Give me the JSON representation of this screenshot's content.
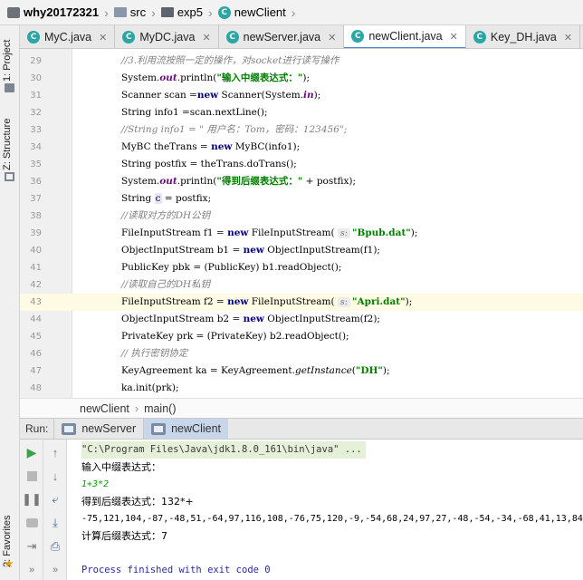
{
  "breadcrumb": {
    "project": "why20172321",
    "src": "src",
    "package": "exp5",
    "file": "newClient"
  },
  "left_tool_windows": {
    "project": "1: Project",
    "structure": "Z: Structure",
    "favorites": "2: Favorites"
  },
  "tabs": [
    {
      "label": "MyC.java"
    },
    {
      "label": "MyDC.java"
    },
    {
      "label": "newServer.java"
    },
    {
      "label": "newClient.java",
      "active": true
    },
    {
      "label": "Key_DH.java"
    }
  ],
  "editor": {
    "highlighted_line": "43",
    "lines": [
      {
        "n": "29",
        "segs": [
          {
            "t": "//3.利用流按照一定的操作，对",
            "c": "cmt"
          },
          {
            "t": "socket",
            "c": "cmt"
          },
          {
            "t": "进行读写操作",
            "c": "cmt"
          }
        ]
      },
      {
        "n": "30",
        "segs": [
          {
            "t": "System."
          },
          {
            "t": "out",
            "c": "fld"
          },
          {
            "t": ".println("
          },
          {
            "t": "\"输入中缀表达式：\"",
            "c": "str"
          },
          {
            "t": ");"
          }
        ]
      },
      {
        "n": "31",
        "segs": [
          {
            "t": "Scanner scan ="
          },
          {
            "t": "new",
            "c": "kw"
          },
          {
            "t": " Scanner(System."
          },
          {
            "t": "in",
            "c": "fld"
          },
          {
            "t": ");"
          }
        ]
      },
      {
        "n": "32",
        "segs": [
          {
            "t": "String info1 =scan.nextLine();"
          }
        ]
      },
      {
        "n": "33",
        "segs": [
          {
            "t": "//String info1 = \" 用户名：Tom，密码：123456\";",
            "c": "cmt"
          }
        ]
      },
      {
        "n": "34",
        "segs": [
          {
            "t": "MyBC theTrans = "
          },
          {
            "t": "new",
            "c": "kw"
          },
          {
            "t": " MyBC(info1);"
          }
        ]
      },
      {
        "n": "35",
        "segs": [
          {
            "t": "String postfix = theTrans.doTrans();"
          }
        ]
      },
      {
        "n": "36",
        "segs": [
          {
            "t": "System."
          },
          {
            "t": "out",
            "c": "fld"
          },
          {
            "t": ".println("
          },
          {
            "t": "\"得到后缀表达式：\"",
            "c": "str"
          },
          {
            "t": " + postfix);"
          }
        ]
      },
      {
        "n": "37",
        "segs": [
          {
            "t": "String "
          },
          {
            "t": "c",
            "c": "varbox"
          },
          {
            "t": " = postfix;"
          }
        ]
      },
      {
        "n": "38",
        "segs": [
          {
            "t": "//读取对方的DH公钥",
            "c": "cmt"
          }
        ]
      },
      {
        "n": "39",
        "segs": [
          {
            "t": "FileInputStream f1 = "
          },
          {
            "t": "new",
            "c": "kw"
          },
          {
            "t": " FileInputStream( "
          },
          {
            "t": "s:",
            "c": "hint"
          },
          {
            "t": "\"Bpub.dat\"",
            "c": "str"
          },
          {
            "t": ");"
          }
        ]
      },
      {
        "n": "40",
        "segs": [
          {
            "t": "ObjectInputStream b1 = "
          },
          {
            "t": "new",
            "c": "kw"
          },
          {
            "t": " ObjectInputStream(f1);"
          }
        ]
      },
      {
        "n": "41",
        "segs": [
          {
            "t": "PublicKey pbk = (PublicKey) b1.readObject();"
          }
        ]
      },
      {
        "n": "42",
        "segs": [
          {
            "t": "//读取自己的DH私钥",
            "c": "cmt"
          }
        ]
      },
      {
        "n": "43",
        "segs": [
          {
            "t": "FileInputStream f2 = "
          },
          {
            "t": "new",
            "c": "kw"
          },
          {
            "t": " FileInputStream( "
          },
          {
            "t": "s:",
            "c": "hint"
          },
          {
            "t": "\"Apri.dat\"",
            "c": "str"
          },
          {
            "t": ");"
          }
        ]
      },
      {
        "n": "44",
        "segs": [
          {
            "t": "ObjectInputStream b2 = "
          },
          {
            "t": "new",
            "c": "kw"
          },
          {
            "t": " ObjectInputStream(f2);"
          }
        ]
      },
      {
        "n": "45",
        "segs": [
          {
            "t": "PrivateKey prk = (PrivateKey) b2.readObject();"
          }
        ]
      },
      {
        "n": "46",
        "segs": [
          {
            "t": "// 执行密钥协定",
            "c": "cmt"
          }
        ]
      },
      {
        "n": "47",
        "segs": [
          {
            "t": "KeyAgreement ka = KeyAgreement."
          },
          {
            "t": "getInstance",
            "c": "ital"
          },
          {
            "t": "("
          },
          {
            "t": "\"DH\"",
            "c": "str"
          },
          {
            "t": ");"
          }
        ]
      },
      {
        "n": "48",
        "segs": [
          {
            "t": "ka.init(prk);"
          }
        ]
      }
    ]
  },
  "editor_breadcrumb": {
    "class_name": "newClient",
    "method": "main()"
  },
  "run_panel": {
    "label": "Run:",
    "tabs": [
      {
        "label": "newServer"
      },
      {
        "label": "newClient",
        "active": true
      }
    ]
  },
  "console": [
    {
      "text": "\"C:\\Program Files\\Java\\jdk1.8.0_161\\bin\\java\" ...",
      "style": "cmd"
    },
    {
      "text": "输入中缀表达式：",
      "style": "out"
    },
    {
      "text": "1+3*2",
      "style": "inp"
    },
    {
      "text": "得到后缀表达式：132*+",
      "style": "out"
    },
    {
      "text": "-75,121,104,-87,-48,51,-64,97,116,108,-76,75,120,-9,-54,68,24,97,27,-48,-54,-34,-68,41,13,84",
      "style": "mono"
    },
    {
      "text": "计算后缀表达式：7",
      "style": "out"
    },
    {
      "text": "",
      "style": "out"
    },
    {
      "text": "Process finished with exit code 0",
      "style": "proc"
    }
  ]
}
